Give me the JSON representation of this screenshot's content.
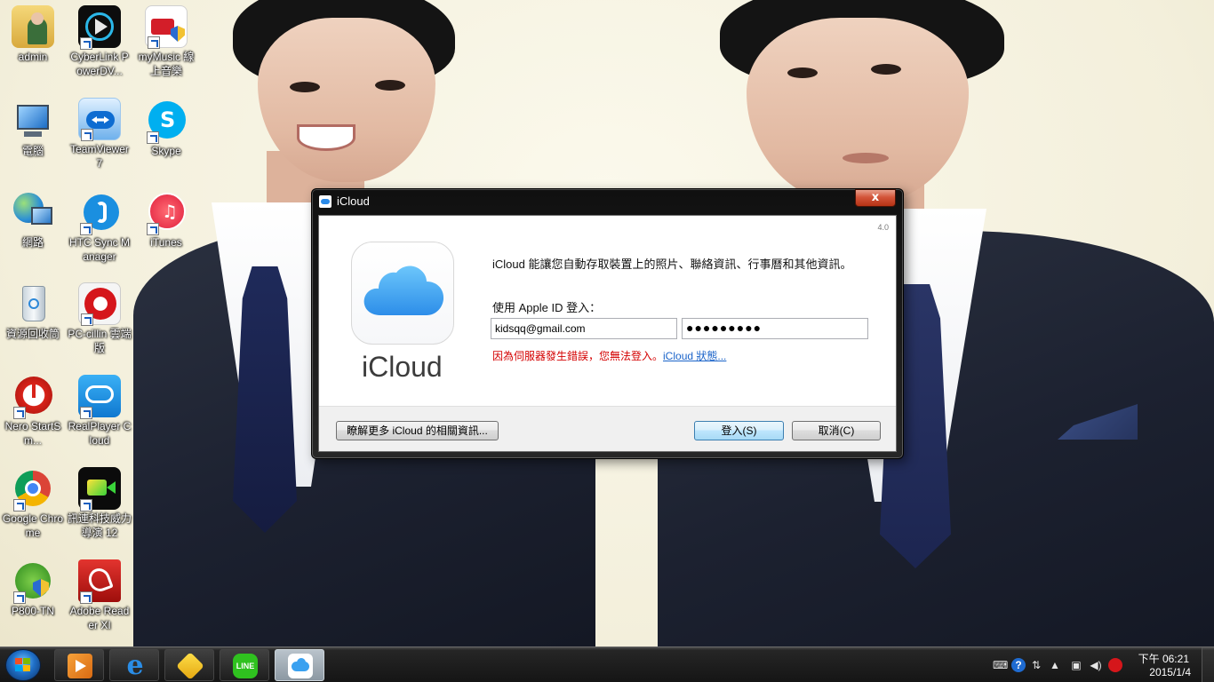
{
  "desktop": {
    "icons": [
      {
        "label": "admin",
        "icon": "user-folder-icon"
      },
      {
        "label": "CyberLink PowerDV...",
        "icon": "cyberlink-powerdvd-icon"
      },
      {
        "label": "myMusic 線上音樂",
        "icon": "mymusic-icon"
      },
      {
        "label": "電腦",
        "icon": "computer-icon"
      },
      {
        "label": "TeamViewer 7",
        "icon": "teamviewer-icon"
      },
      {
        "label": "Skype",
        "icon": "skype-icon"
      },
      {
        "label": "網路",
        "icon": "network-icon"
      },
      {
        "label": "HTC Sync Manager",
        "icon": "htc-sync-icon"
      },
      {
        "label": "iTunes",
        "icon": "itunes-icon"
      },
      {
        "label": "資源回收筒",
        "icon": "recycle-bin-icon"
      },
      {
        "label": "PC-cillin 雲端版",
        "icon": "pc-cillin-icon"
      },
      {
        "label": "Nero StartSm...",
        "icon": "nero-icon"
      },
      {
        "label": "RealPlayer Cloud",
        "icon": "realplayer-icon"
      },
      {
        "label": "Google Chrome",
        "icon": "chrome-icon"
      },
      {
        "label": "訊連科技威力導演 12",
        "icon": "powerdirector-icon"
      },
      {
        "label": "P800-TN",
        "icon": "p800-icon"
      },
      {
        "label": "Adobe Reader XI",
        "icon": "adobe-reader-icon"
      }
    ]
  },
  "dialog": {
    "title": "iCloud",
    "close_label": "x",
    "version": "4.0",
    "app_name": "iCloud",
    "description": "iCloud 能讓您自動存取裝置上的照片、聯絡資訊、行事曆和其他資訊。",
    "signin_label": "使用 Apple ID 登入：",
    "apple_id_value": "kidsqq@gmail.com",
    "password_value": "●●●●●●●●●",
    "error_text": "因為伺服器發生錯誤，您無法登入。",
    "status_link": "iCloud 狀態...",
    "learn_more_label": "瞭解更多 iCloud 的相關資訊...",
    "signin_button_label": "登入(S)",
    "cancel_button_label": "取消(C)"
  },
  "taskbar": {
    "pinned": [
      {
        "name": "media-player",
        "icon": "media-player-icon"
      },
      {
        "name": "internet-explorer",
        "icon": "internet-explorer-icon"
      },
      {
        "name": "kmplayer",
        "icon": "kmplayer-icon"
      },
      {
        "name": "line",
        "icon": "line-icon",
        "text": "LINE"
      },
      {
        "name": "icloud",
        "icon": "icloud-icon"
      }
    ],
    "clock_time": "下午 06:21",
    "clock_date": "2015/1/4",
    "help_glyph": "?"
  },
  "colors": {
    "error_red": "#d40000",
    "link_blue": "#1a63c9",
    "icloud_blue": "#3aa1f0",
    "close_red": "#c7401f"
  }
}
